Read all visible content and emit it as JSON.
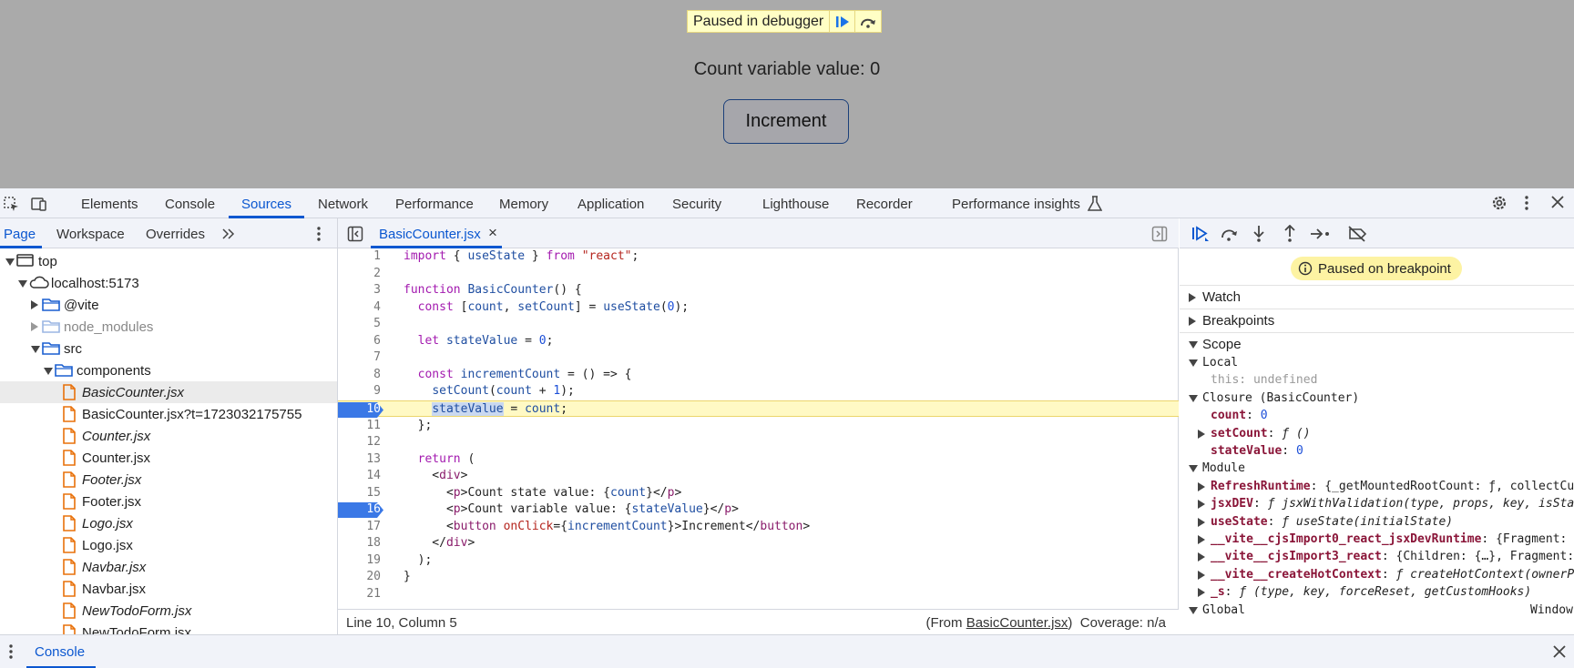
{
  "app": {
    "paused_label": "Paused in debugger",
    "count_text": "Count variable value: 0",
    "increment_label": "Increment"
  },
  "devtools": {
    "tabs": [
      "Elements",
      "Console",
      "Sources",
      "Network",
      "Performance",
      "Memory",
      "Application",
      "Security",
      "Lighthouse",
      "Recorder",
      "Performance insights"
    ],
    "active_tab": "Sources"
  },
  "navigator": {
    "tabs": [
      "Page",
      "Workspace",
      "Overrides"
    ],
    "active_tab": "Page",
    "tree": [
      {
        "label": "top",
        "depth": 0,
        "type": "frame",
        "expanded": true
      },
      {
        "label": "localhost:5173",
        "depth": 1,
        "type": "cloud",
        "expanded": true
      },
      {
        "label": "@vite",
        "depth": 2,
        "type": "folder",
        "expanded": false
      },
      {
        "label": "node_modules",
        "depth": 2,
        "type": "folder-dim",
        "expanded": false
      },
      {
        "label": "src",
        "depth": 2,
        "type": "folder",
        "expanded": true
      },
      {
        "label": "components",
        "depth": 3,
        "type": "folder",
        "expanded": true
      },
      {
        "label": "BasicCounter.jsx",
        "depth": 4,
        "type": "file",
        "italic": true,
        "selected": true
      },
      {
        "label": "BasicCounter.jsx?t=1723032175755",
        "depth": 4,
        "type": "file"
      },
      {
        "label": "Counter.jsx",
        "depth": 4,
        "type": "file",
        "italic": true
      },
      {
        "label": "Counter.jsx",
        "depth": 4,
        "type": "file"
      },
      {
        "label": "Footer.jsx",
        "depth": 4,
        "type": "file",
        "italic": true
      },
      {
        "label": "Footer.jsx",
        "depth": 4,
        "type": "file"
      },
      {
        "label": "Logo.jsx",
        "depth": 4,
        "type": "file",
        "italic": true
      },
      {
        "label": "Logo.jsx",
        "depth": 4,
        "type": "file"
      },
      {
        "label": "Navbar.jsx",
        "depth": 4,
        "type": "file",
        "italic": true
      },
      {
        "label": "Navbar.jsx",
        "depth": 4,
        "type": "file"
      },
      {
        "label": "NewTodoForm.jsx",
        "depth": 4,
        "type": "file",
        "italic": true
      },
      {
        "label": "NewTodoForm.jsx",
        "depth": 4,
        "type": "file"
      }
    ]
  },
  "editor": {
    "file_tab": "BasicCounter.jsx",
    "breakpoint_lines": [
      10,
      16
    ],
    "current_line": 10,
    "lines": [
      "import { useState } from \"react\";",
      "",
      "function BasicCounter() {",
      "  const [count, setCount] = useState(0);",
      "",
      "  let stateValue = 0;",
      "",
      "  const incrementCount = () => {",
      "    setCount(count + 1);",
      "    stateValue = count;",
      "  };",
      "",
      "  return (",
      "    <div>",
      "      <p>Count state value: {count}</p>",
      "      <p>Count variable value: {stateValue}</p>",
      "      <button onClick={incrementCount}>Increment</button>",
      "    </div>",
      "  );",
      "}",
      ""
    ],
    "status": {
      "cursor": "Line 10, Column 5",
      "from_prefix": "(From ",
      "from_file": "BasicCounter.jsx",
      "from_suffix": ")",
      "coverage": "Coverage: n/a"
    }
  },
  "debugger": {
    "paused_badge": "Paused on breakpoint",
    "sections": {
      "watch": "Watch",
      "breakpoints": "Breakpoints",
      "scope": "Scope"
    },
    "scope": {
      "local_title": "Local",
      "this_key": "this",
      "this_val": "undefined",
      "closure_title": "Closure (BasicCounter)",
      "closure": [
        {
          "key": "count",
          "val": "0"
        },
        {
          "key": "setCount",
          "val": "ƒ ()"
        },
        {
          "key": "stateValue",
          "val": "0"
        }
      ],
      "module_title": "Module",
      "module": [
        {
          "key": "RefreshRuntime",
          "val": "{_getMountedRootCount: ƒ, collectCu"
        },
        {
          "key": "jsxDEV",
          "val": "ƒ jsxWithValidation(type, props, key, isSta"
        },
        {
          "key": "useState",
          "val": "ƒ useState(initialState)"
        },
        {
          "key": "__vite__cjsImport0_react_jsxDevRuntime",
          "val": "{Fragment:"
        },
        {
          "key": "__vite__cjsImport3_react",
          "val": "{Children: {…}, Fragment:"
        },
        {
          "key": "__vite__createHotContext",
          "val": "ƒ createHotContext(ownerP"
        },
        {
          "key": "_s",
          "val": "ƒ (type, key, forceReset, getCustomHooks)"
        }
      ],
      "global_title": "Global",
      "global_val": "Window"
    }
  },
  "drawer": {
    "tab": "Console"
  },
  "colors": {
    "accent": "#0b57d0",
    "breakpoint": "#3a78e6",
    "highlight": "#fff9c4"
  }
}
